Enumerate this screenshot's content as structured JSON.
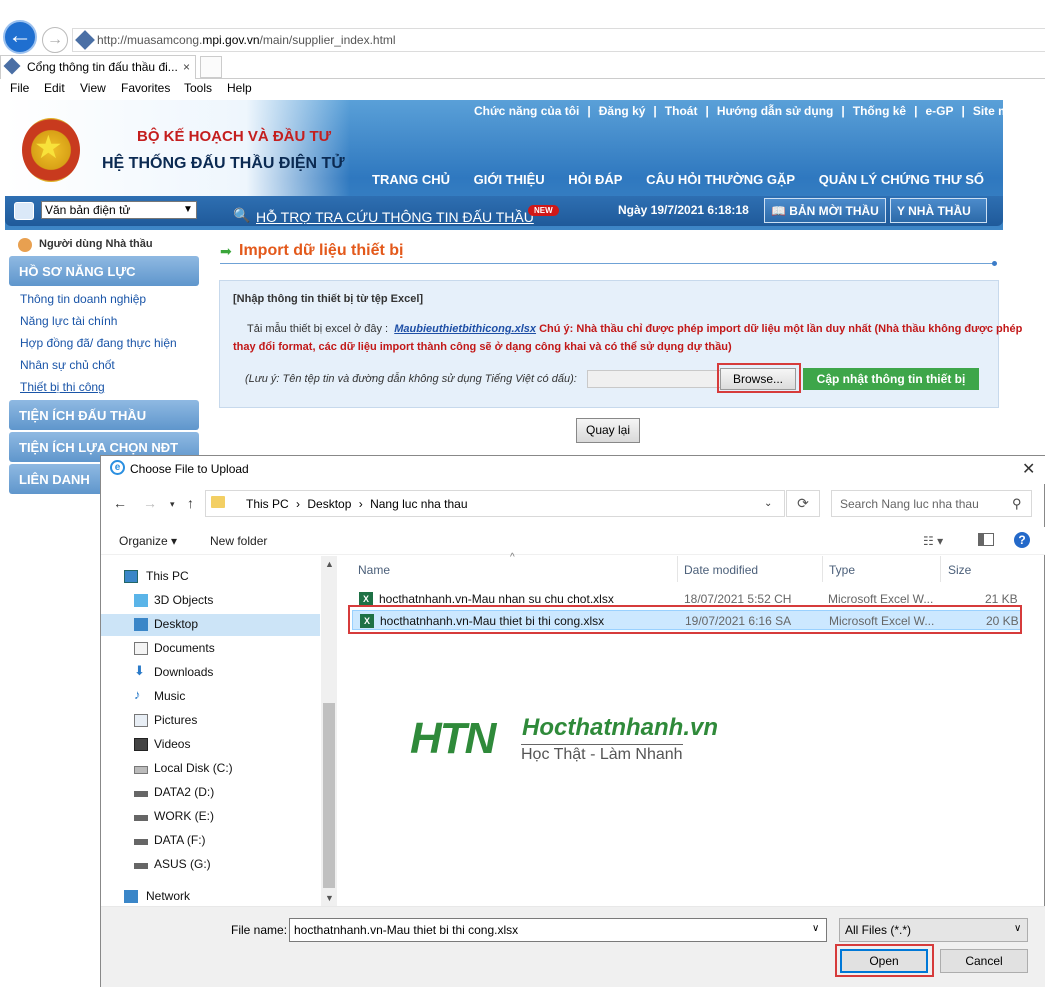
{
  "browser": {
    "url_prefix": "http://muasamcong.",
    "url_domain": "mpi.gov.vn",
    "url_suffix": "/main/supplier_index.html",
    "tab_title": "Cổng thông tin đấu thầu đi...",
    "tab_close": "×",
    "menu": [
      "File",
      "Edit",
      "View",
      "Favorites",
      "Tools",
      "Help"
    ]
  },
  "site": {
    "org_line1": "BỘ KẾ HOẠCH VÀ ĐẦU TƯ",
    "org_line2": "HỆ THỐNG ĐẤU THẦU ĐIỆN TỬ",
    "top_nav": [
      "Chức năng của tôi",
      "|",
      "Đăng ký",
      "|",
      "Thoát",
      "|",
      "Hướng dẫn sử dụng",
      "|",
      "Thống kê",
      "|",
      "e-GP",
      "|",
      "Site m"
    ],
    "main_nav": [
      "TRANG CHỦ",
      "GIỚI THIỆU",
      "HỎI ĐÁP",
      "CÂU HỎI THƯỜNG GẶP",
      "QUẢN LÝ CHỨNG THƯ SỐ"
    ],
    "doc_select": "Văn bản điện tử",
    "support_link": "HỖ TRỢ TRA CỨU THÔNG TIN ĐẤU THẦU",
    "new_badge": "NEW",
    "date": "Ngày 19/7/2021 6:18:18",
    "btn_invite": "BẢN MỜI THẦU",
    "btn_contractor": "NHÀ THẦU"
  },
  "sidebar": {
    "user": "Người dùng Nhà thầu",
    "section1": "HỒ SƠ NĂNG LỰC",
    "items": [
      "Thông tin doanh nghiệp",
      "Năng lực tài chính",
      "Hợp đồng đã/ đang thực hiện",
      "Nhân sự chủ chốt",
      "Thiết bị thi công"
    ],
    "section2": "TIỆN ÍCH ĐẤU THẦU",
    "section3": "TIỆN ÍCH LỰA CHỌN NĐT",
    "section4": "LIÊN DANH"
  },
  "main": {
    "title": "Import dữ liệu thiết bị",
    "panel_title": "[Nhập thông tin thiết bị từ tệp Excel]",
    "template_prefix": "Tải mẫu thiết bị excel ở đây :",
    "template_link": "Maubieuthietbithicong.xlsx",
    "warning_line1": "Chú ý: Nhà thầu chỉ được phép import dữ liệu một lần duy nhất (Nhà thầu không được phép",
    "warning_line2": "thay đổi format, các dữ liệu import thành công sẽ ở dạng công khai và có thể sử dụng dự thầu)",
    "note": "(Lưu ý: Tên tệp tin và đường dẫn không sử dụng Tiếng Việt có dấu):",
    "browse": "Browse...",
    "update": "Cập nhật thông tin thiết bị",
    "back": "Quay lại"
  },
  "dialog": {
    "title": "Choose File to Upload",
    "close": "✕",
    "path": [
      "This PC",
      "›",
      "Desktop",
      "›",
      "Nang luc nha thau"
    ],
    "search_placeholder": "Search Nang luc nha thau",
    "organize": "Organize ▾",
    "new_folder": "New folder",
    "nav": [
      {
        "label": "This PC",
        "icon": "pc-icon"
      },
      {
        "label": "3D Objects",
        "icon": "cube-icon"
      },
      {
        "label": "Desktop",
        "icon": "desktop-icon"
      },
      {
        "label": "Documents",
        "icon": "documents-icon"
      },
      {
        "label": "Downloads",
        "icon": "download-icon"
      },
      {
        "label": "Music",
        "icon": "music-icon"
      },
      {
        "label": "Pictures",
        "icon": "pictures-icon"
      },
      {
        "label": "Videos",
        "icon": "videos-icon"
      },
      {
        "label": "Local Disk (C:)",
        "icon": "disk-icon"
      },
      {
        "label": "DATA2 (D:)",
        "icon": "drive-icon"
      },
      {
        "label": "WORK (E:)",
        "icon": "drive-icon"
      },
      {
        "label": "DATA (F:)",
        "icon": "drive-icon"
      },
      {
        "label": "ASUS (G:)",
        "icon": "drive-icon"
      },
      {
        "label": "Network",
        "icon": "network-icon"
      }
    ],
    "columns": [
      "Name",
      "Date modified",
      "Type",
      "Size"
    ],
    "files": [
      {
        "name": "hocthatnhanh.vn-Mau nhan su chu chot.xlsx",
        "date": "18/07/2021 5:52 CH",
        "type": "Microsoft Excel W...",
        "size": "21 KB"
      },
      {
        "name": "hocthatnhanh.vn-Mau thiet bi thi cong.xlsx",
        "date": "19/07/2021 6:16 SA",
        "type": "Microsoft Excel W...",
        "size": "20 KB"
      }
    ],
    "watermark_htn": "HTN",
    "watermark_site": "Hocthatnhanh.vn",
    "watermark_slogan": "Học Thật - Làm Nhanh",
    "file_name_label": "File name:",
    "file_name_value": "hocthatnhanh.vn-Mau thiet bi thi cong.xlsx",
    "file_type": "All Files (*.*)",
    "open": "Open",
    "cancel": "Cancel"
  }
}
